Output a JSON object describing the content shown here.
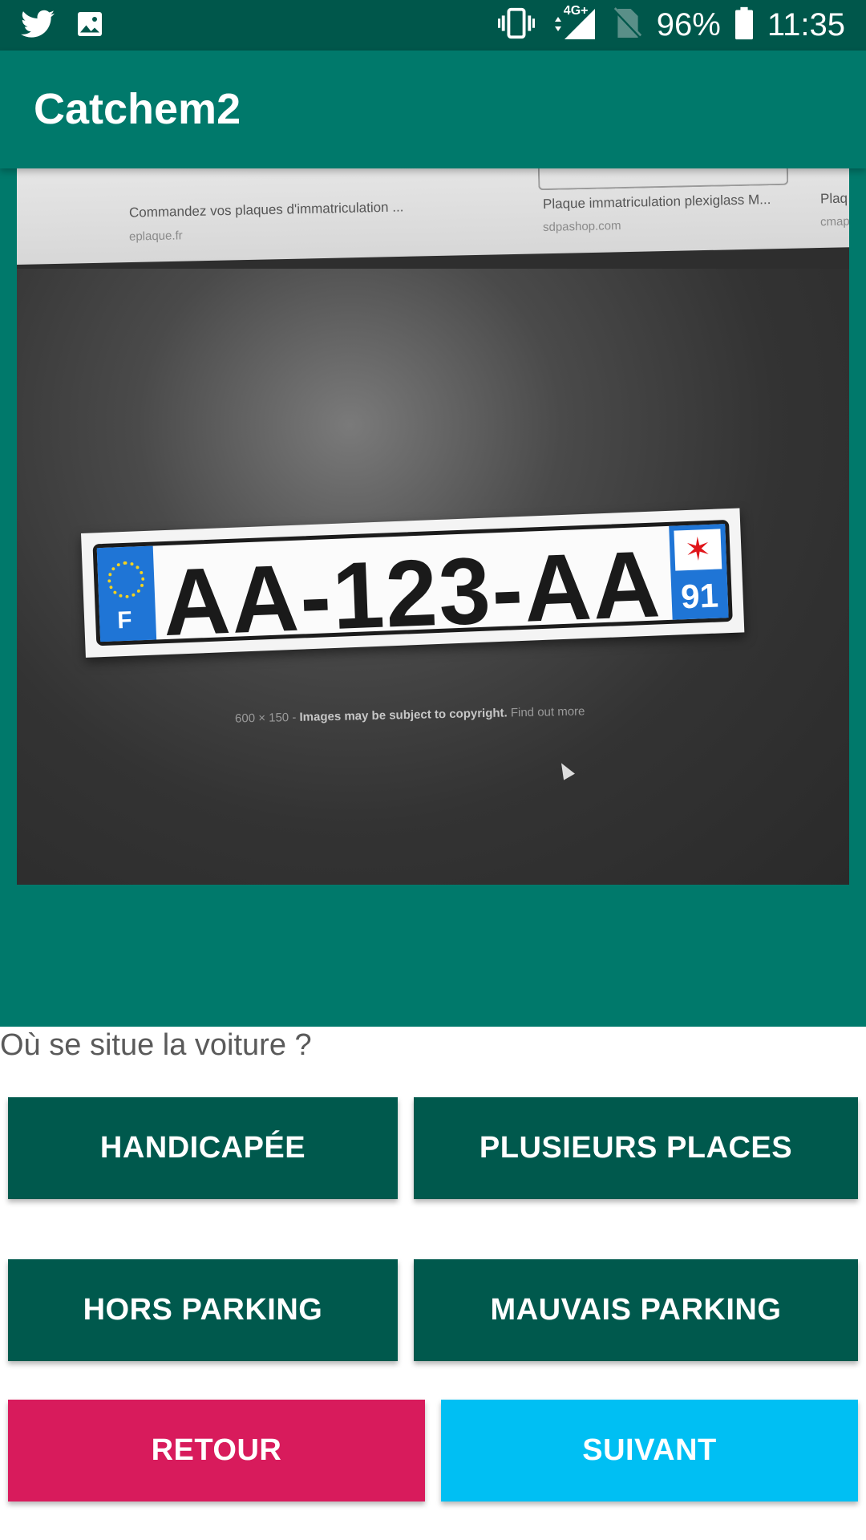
{
  "status_bar": {
    "notifications": [
      "twitter-icon",
      "image-icon"
    ],
    "network": "4G+",
    "battery": "96%",
    "time": "11:35"
  },
  "app_bar": {
    "title": "Catchem2"
  },
  "photo": {
    "search_results": [
      {
        "title": "Commandez vos plaques d'immatriculation ...",
        "domain": "eplaque.fr"
      },
      {
        "title": "Plaque immatriculation plexiglass M...",
        "domain": "sdpashop.com"
      },
      {
        "title": "Plaq",
        "domain": "cmap"
      }
    ],
    "plate_text": "AA-123-AA",
    "plate_country": "F",
    "plate_department": "91",
    "caption_size": "600 × 150",
    "caption_copyright": "Images may be subject to copyright.",
    "caption_link": "Find out more"
  },
  "question": "Où se situe la voiture ?",
  "buttons": {
    "handicapee": "HANDICAPÉE",
    "plusieurs_places": "PLUSIEURS PLACES",
    "hors_parking": "HORS PARKING",
    "mauvais_parking": "MAUVAIS PARKING",
    "retour": "RETOUR",
    "suivant": "SUIVANT"
  },
  "colors": {
    "status_bar": "#00574b",
    "app_bar": "#00796b",
    "choice_button": "#00594d",
    "retour_button": "#d81b5c",
    "suivant_button": "#00bff3"
  }
}
